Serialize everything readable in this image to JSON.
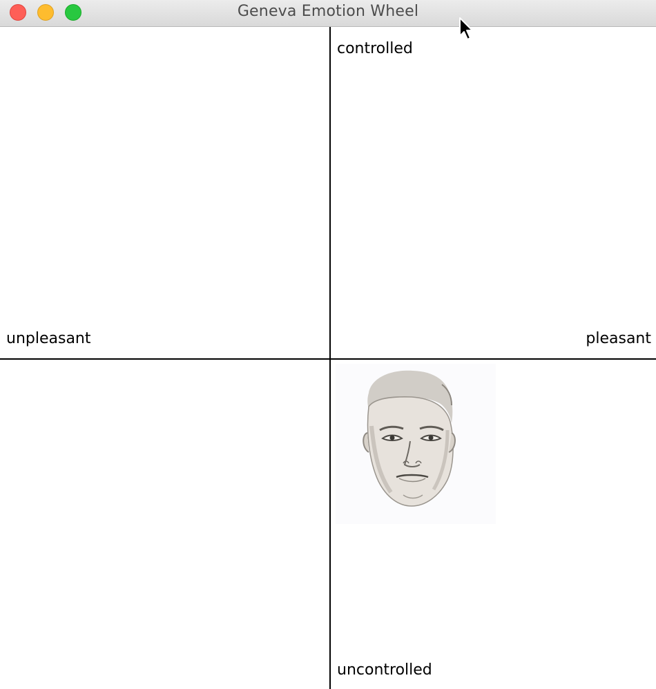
{
  "window": {
    "title": "Geneva Emotion Wheel",
    "buttons": [
      "close",
      "minimize",
      "maximize"
    ]
  },
  "axes": {
    "top_label": "controlled",
    "bottom_label": "uncontrolled",
    "left_label": "unpleasant",
    "right_label": "pleasant"
  },
  "stimulus": {
    "icon": "face-sketch-icon"
  },
  "colors": {
    "close": "#fe5f57",
    "minimize": "#febc2e",
    "maximize": "#28c840",
    "axis": "#000000",
    "background": "#ffffff"
  }
}
